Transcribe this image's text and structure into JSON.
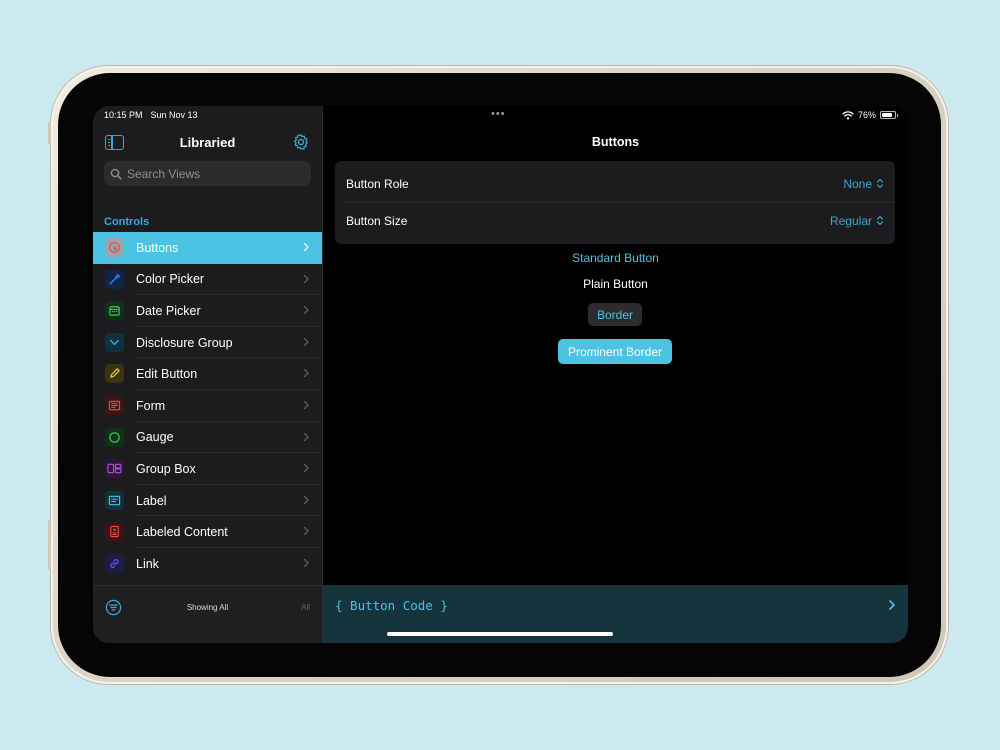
{
  "status_bar": {
    "time": "10:15 PM",
    "date": "Sun Nov 13",
    "battery": "76%"
  },
  "sidebar": {
    "title": "Libraried",
    "search_placeholder": "Search Views",
    "section_header": "Controls",
    "items": [
      {
        "label": "Buttons",
        "icon": "button-icon",
        "color": "#e5534b",
        "selected": true
      },
      {
        "label": "Color Picker",
        "icon": "eyedropper-icon",
        "color": "#2f7cf6"
      },
      {
        "label": "Date Picker",
        "icon": "calendar-icon",
        "color": "#34c759"
      },
      {
        "label": "Disclosure Group",
        "icon": "chevron-down-icon",
        "color": "#3aa8d8"
      },
      {
        "label": "Edit Button",
        "icon": "pencil-icon",
        "color": "#e5c73b"
      },
      {
        "label": "Form",
        "icon": "form-icon",
        "color": "#e5534b"
      },
      {
        "label": "Gauge",
        "icon": "gauge-icon",
        "color": "#34c759"
      },
      {
        "label": "Group Box",
        "icon": "group-box-icon",
        "color": "#af52de"
      },
      {
        "label": "Label",
        "icon": "label-icon",
        "color": "#4cc3e2"
      },
      {
        "label": "Labeled Content",
        "icon": "labeled-content-icon",
        "color": "#e5534b"
      },
      {
        "label": "Link",
        "icon": "link-icon",
        "color": "#5e5ce6"
      }
    ],
    "footer": {
      "showing": "Showing All",
      "all": "All"
    }
  },
  "detail": {
    "title": "Buttons",
    "settings": [
      {
        "label": "Button Role",
        "value": "None"
      },
      {
        "label": "Button Size",
        "value": "Regular"
      }
    ],
    "buttons": {
      "standard": "Standard Button",
      "plain": "Plain Button",
      "border": "Border",
      "prominent": "Prominent Border"
    },
    "code_bar": {
      "label": "{ Button Code }"
    }
  },
  "colors": {
    "accent": "#4cc3e2",
    "link": "#3aa8d8",
    "background": "#000000",
    "sidebar": "#1c1c1e"
  }
}
